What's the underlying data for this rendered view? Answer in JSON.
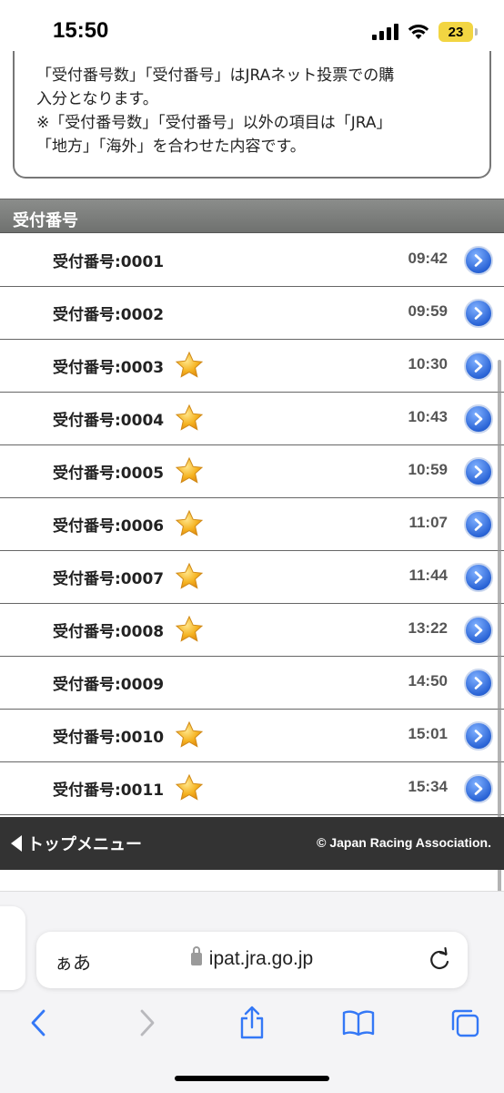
{
  "status_bar": {
    "time": "15:50",
    "battery": "23"
  },
  "notice": {
    "line1": "「受付番号数」「受付番号」はJRAネット投票での購",
    "line2": "入分となります。",
    "line3": "※「受付番号数」「受付番号」以外の項目は「JRA」",
    "line4": "「地方」「海外」を合わせた内容です。"
  },
  "section": {
    "title": "受付番号"
  },
  "receipts": [
    {
      "label": "受付番号:0001",
      "time": "09:42",
      "starred": false
    },
    {
      "label": "受付番号:0002",
      "time": "09:59",
      "starred": false
    },
    {
      "label": "受付番号:0003",
      "time": "10:30",
      "starred": true
    },
    {
      "label": "受付番号:0004",
      "time": "10:43",
      "starred": true
    },
    {
      "label": "受付番号:0005",
      "time": "10:59",
      "starred": true
    },
    {
      "label": "受付番号:0006",
      "time": "11:07",
      "starred": true
    },
    {
      "label": "受付番号:0007",
      "time": "11:44",
      "starred": true
    },
    {
      "label": "受付番号:0008",
      "time": "13:22",
      "starred": true
    },
    {
      "label": "受付番号:0009",
      "time": "14:50",
      "starred": false
    },
    {
      "label": "受付番号:0010",
      "time": "15:01",
      "starred": true
    },
    {
      "label": "受付番号:0011",
      "time": "15:34",
      "starred": true
    }
  ],
  "footer": {
    "back_label": "トップメニュー",
    "copyright": "© Japan Racing Association."
  },
  "browser": {
    "aa_label": "ぁあ",
    "url": "ipat.jra.go.jp"
  },
  "icons": {
    "star": "star-icon",
    "arrow": "chevron-right-circle-icon",
    "back": "triangle-left-icon"
  },
  "colors": {
    "section_header": "#7e807e",
    "footer_bar": "#333333",
    "arrow_blue": "#2a64d6",
    "star_gold": "#f5b321",
    "ios_blue": "#3478f6"
  }
}
